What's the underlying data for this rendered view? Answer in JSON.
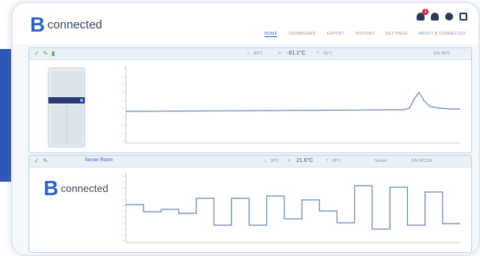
{
  "app": {
    "logo_letter": "B",
    "logo_text": "connected"
  },
  "header": {
    "notification_count": "1",
    "nav": [
      {
        "label": "HOME",
        "active": true
      },
      {
        "label": "DASHBOARD",
        "active": false
      },
      {
        "label": "EXPORT",
        "active": false
      },
      {
        "label": "HISTORY",
        "active": false
      },
      {
        "label": "SETTINGS",
        "active": false
      },
      {
        "label": "ABOUT B CONNECTED",
        "active": false
      }
    ]
  },
  "panels": [
    {
      "name": "",
      "alarm_low": "-85°C",
      "current_temp": "-81.1°C",
      "alarm_high": "-65°C",
      "serial": "S/N 4875",
      "has_fridge_image": true
    },
    {
      "name": "Server Room",
      "alarm_low": "18°C",
      "current_temp": "21.6°C",
      "alarm_high": "28°C",
      "type": "Sensor",
      "serial": "S/N 001234"
    }
  ],
  "colors": {
    "accent": "#2a62c9",
    "line": "#6a87b8",
    "ok_green": "#4caf50",
    "badge_red": "#e0283a"
  },
  "icons": [
    "check-icon",
    "edit-icon",
    "battery-icon",
    "bell-icon",
    "users-icon",
    "gear-icon",
    "logout-icon",
    "low-alarm-icon",
    "thermometer-icon",
    "high-alarm-icon"
  ]
}
